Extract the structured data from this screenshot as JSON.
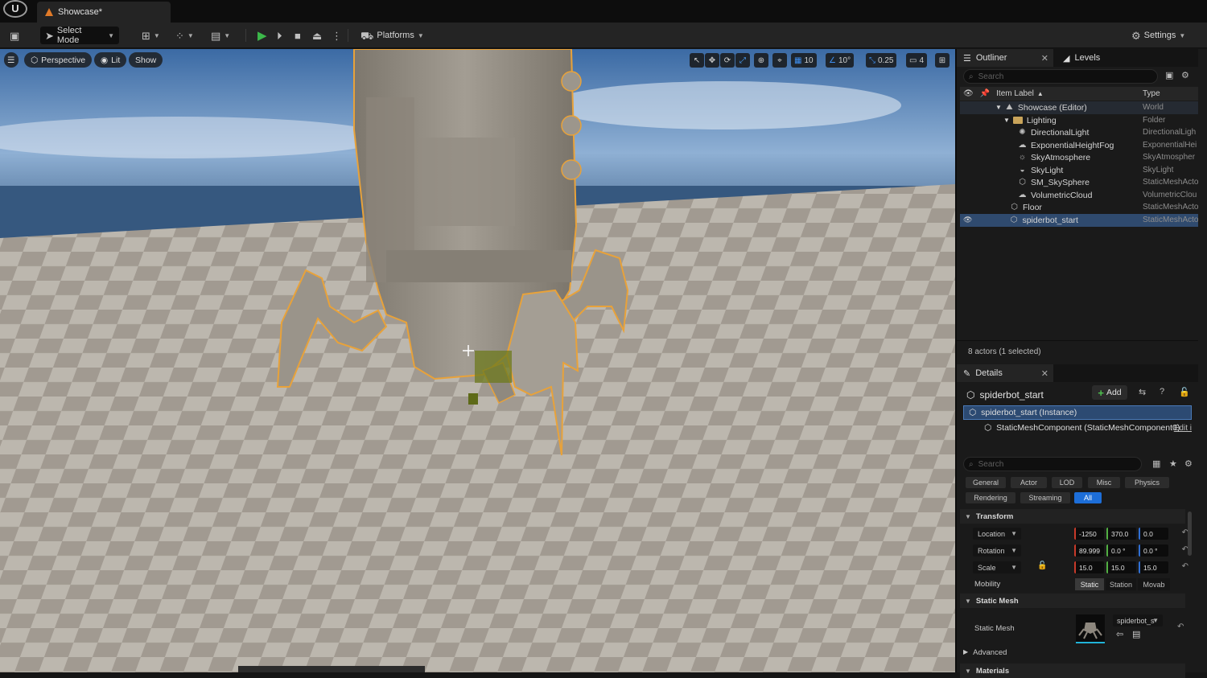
{
  "window": {
    "tab_title": "Showcase*"
  },
  "toolbar": {
    "select_mode": "Select Mode",
    "platforms": "Platforms",
    "settings": "Settings"
  },
  "viewport": {
    "perspective": "Perspective",
    "lit": "Lit",
    "show": "Show",
    "grid_snap": "10",
    "angle_snap": "10°",
    "scale_snap": "0.25",
    "camera_speed": "4"
  },
  "outliner": {
    "tab_label": "Outliner",
    "levels_tab": "Levels",
    "search_placeholder": "Search",
    "col_label": "Item Label",
    "col_type": "Type",
    "rows": [
      {
        "label": "Showcase (Editor)",
        "type": "World"
      },
      {
        "label": "Lighting",
        "type": "Folder"
      },
      {
        "label": "DirectionalLight",
        "type": "DirectionalLigh"
      },
      {
        "label": "ExponentialHeightFog",
        "type": "ExponentialHei"
      },
      {
        "label": "SkyAtmosphere",
        "type": "SkyAtmospher"
      },
      {
        "label": "SkyLight",
        "type": "SkyLight"
      },
      {
        "label": "SM_SkySphere",
        "type": "StaticMeshActo"
      },
      {
        "label": "VolumetricCloud",
        "type": "VolumetricClou"
      },
      {
        "label": "Floor",
        "type": "StaticMeshActo"
      },
      {
        "label": "spiderbot_start",
        "type": "StaticMeshActo"
      }
    ],
    "status": "8 actors (1 selected)"
  },
  "details": {
    "tab_label": "Details",
    "actor_name": "spiderbot_start",
    "add_label": "Add",
    "instance_row": "spiderbot_start (Instance)",
    "component_row": "StaticMeshComponent (StaticMeshComponent0)",
    "edit_link": "Edit i",
    "search_placeholder": "Search",
    "filters": [
      "General",
      "Actor",
      "LOD",
      "Misc",
      "Physics",
      "Rendering",
      "Streaming",
      "All"
    ],
    "transform_header": "Transform",
    "location_label": "Location",
    "location": {
      "x": "-1250",
      "y": "370.0",
      "z": "0.0"
    },
    "rotation_label": "Rotation",
    "rotation": {
      "x": "89.999",
      "y": "0.0 °",
      "z": "0.0 °"
    },
    "scale_label": "Scale",
    "scale": {
      "x": "15.0",
      "y": "15.0",
      "z": "15.0"
    },
    "mobility_label": "Mobility",
    "mobility_options": [
      "Static",
      "Station",
      "Movab"
    ],
    "static_mesh_header": "Static Mesh",
    "static_mesh_label": "Static Mesh",
    "static_mesh_value": "spiderbot_s",
    "advanced_label": "Advanced",
    "materials_header": "Materials"
  },
  "colors": {
    "accent_blue": "#1d6ed8",
    "play_green": "#3cb84a",
    "selection_orange": "#e8a23a"
  }
}
